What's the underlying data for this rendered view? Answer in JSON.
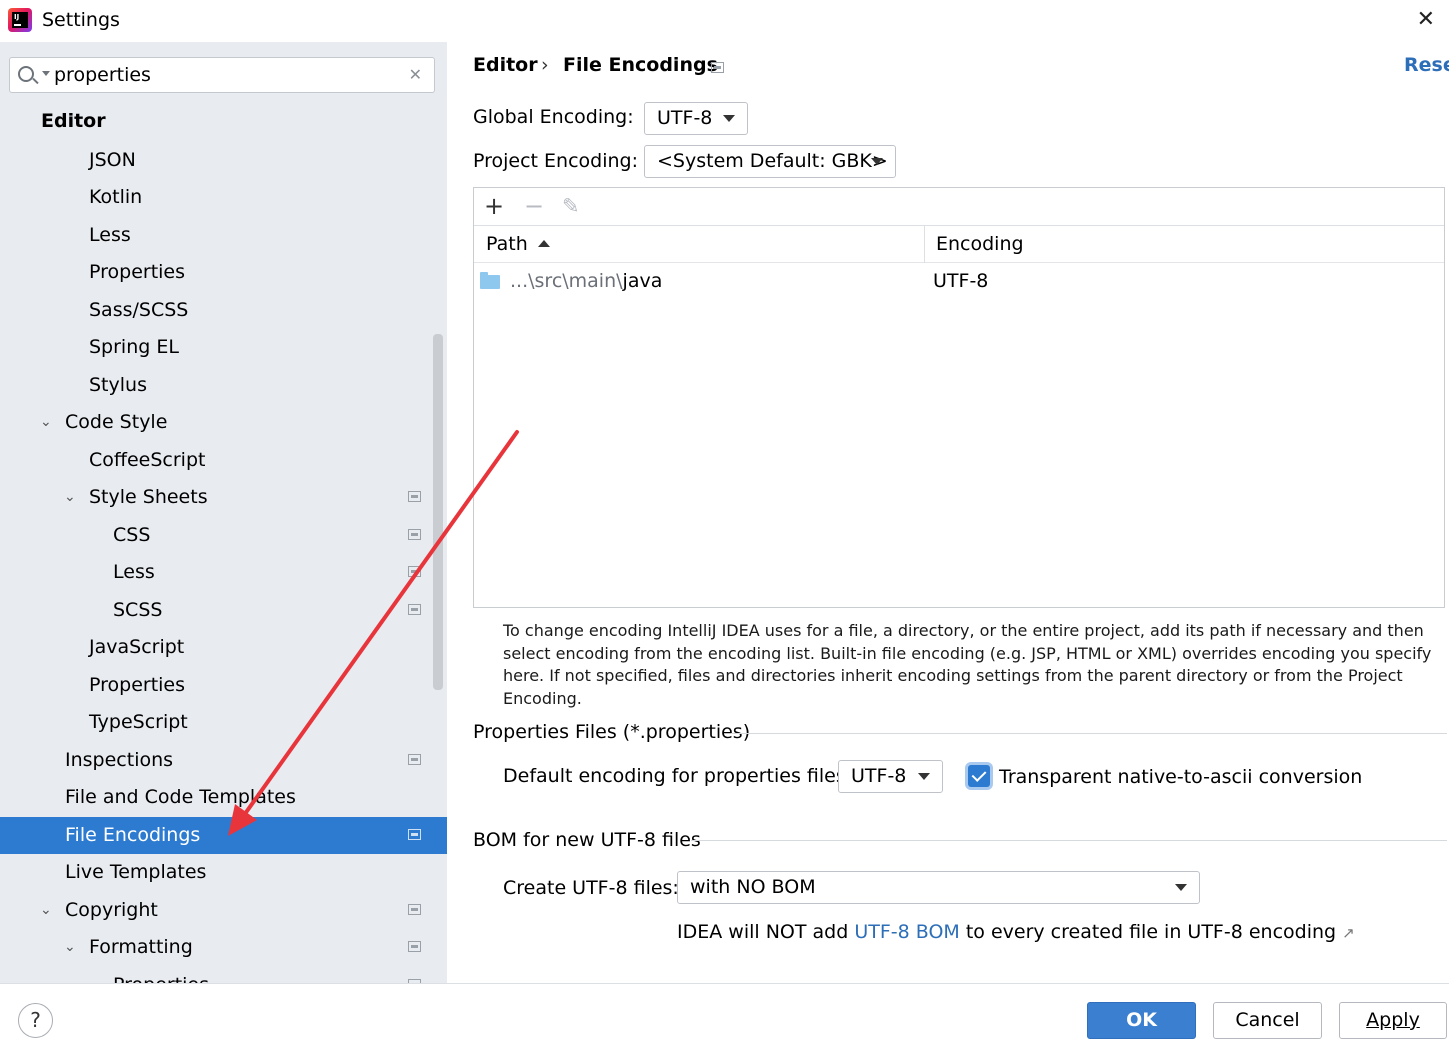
{
  "window": {
    "title": "Settings"
  },
  "search": {
    "query": "properties"
  },
  "sidebar": {
    "items": [
      {
        "label": "Editor",
        "chevron": ""
      },
      {
        "label": "JSON",
        "chevron": ""
      },
      {
        "label": "Kotlin",
        "chevron": ""
      },
      {
        "label": "Less",
        "chevron": ""
      },
      {
        "label": "Properties",
        "chevron": ""
      },
      {
        "label": "Sass/SCSS",
        "chevron": ""
      },
      {
        "label": "Spring EL",
        "chevron": ""
      },
      {
        "label": "Stylus",
        "chevron": ""
      },
      {
        "label": "Code Style",
        "chevron": "⌄"
      },
      {
        "label": "CoffeeScript",
        "chevron": ""
      },
      {
        "label": "Style Sheets",
        "chevron": "⌄"
      },
      {
        "label": "CSS",
        "chevron": ""
      },
      {
        "label": "Less",
        "chevron": ""
      },
      {
        "label": "SCSS",
        "chevron": ""
      },
      {
        "label": "JavaScript",
        "chevron": ""
      },
      {
        "label": "Properties",
        "chevron": ""
      },
      {
        "label": "TypeScript",
        "chevron": ""
      },
      {
        "label": "Inspections",
        "chevron": ""
      },
      {
        "label": "File and Code Templates",
        "chevron": ""
      },
      {
        "label": "File Encodings",
        "chevron": ""
      },
      {
        "label": "Live Templates",
        "chevron": ""
      },
      {
        "label": "Copyright",
        "chevron": "⌄"
      },
      {
        "label": "Formatting",
        "chevron": "⌄"
      },
      {
        "label": "Properties",
        "chevron": ""
      }
    ],
    "selected": "File Encodings"
  },
  "breadcrumb": {
    "parent": "Editor",
    "separator": "›",
    "current": "File Encodings"
  },
  "reset_label": "Reset",
  "encodings": {
    "global_label": "Global Encoding:",
    "global_value": "UTF-8",
    "project_label": "Project Encoding:",
    "project_value": "<System Default: GBK>"
  },
  "table": {
    "toolbar": {
      "add": "+",
      "remove": "−",
      "edit": "✎"
    },
    "columns": [
      "Path",
      "Encoding"
    ],
    "rows": [
      {
        "path_prefix": "...\\src\\main\\",
        "path_name": "java",
        "encoding": "UTF-8"
      }
    ]
  },
  "help_text": "To change encoding IntelliJ IDEA uses for a file, a directory, or the entire project, add its path if necessary and then select encoding from the encoding list. Built-in file encoding (e.g. JSP, HTML or XML) overrides encoding you specify here. If not specified, files and directories inherit encoding settings from the parent directory or from the Project Encoding.",
  "properties_files": {
    "section_title": "Properties Files (*.properties)",
    "default_label": "Default encoding for properties files:",
    "default_value": "UTF-8",
    "transparent_label": "Transparent native-to-ascii conversion",
    "transparent_checked": true
  },
  "bom": {
    "section_title": "BOM for new UTF-8 files",
    "create_label": "Create UTF-8 files:",
    "create_value": "with NO BOM",
    "note_before": "IDEA will NOT add ",
    "note_link": "UTF-8 BOM",
    "note_after": " to every created file in UTF-8 encoding",
    "note_icon": "↗"
  },
  "footer": {
    "help": "?",
    "ok": "OK",
    "cancel": "Cancel",
    "apply": "Apply"
  },
  "colors": {
    "accent": "#2d7bd1",
    "sidebar_bg": "#e8ebf0",
    "link": "#2d6eb8",
    "annotation": "#e8353b"
  }
}
